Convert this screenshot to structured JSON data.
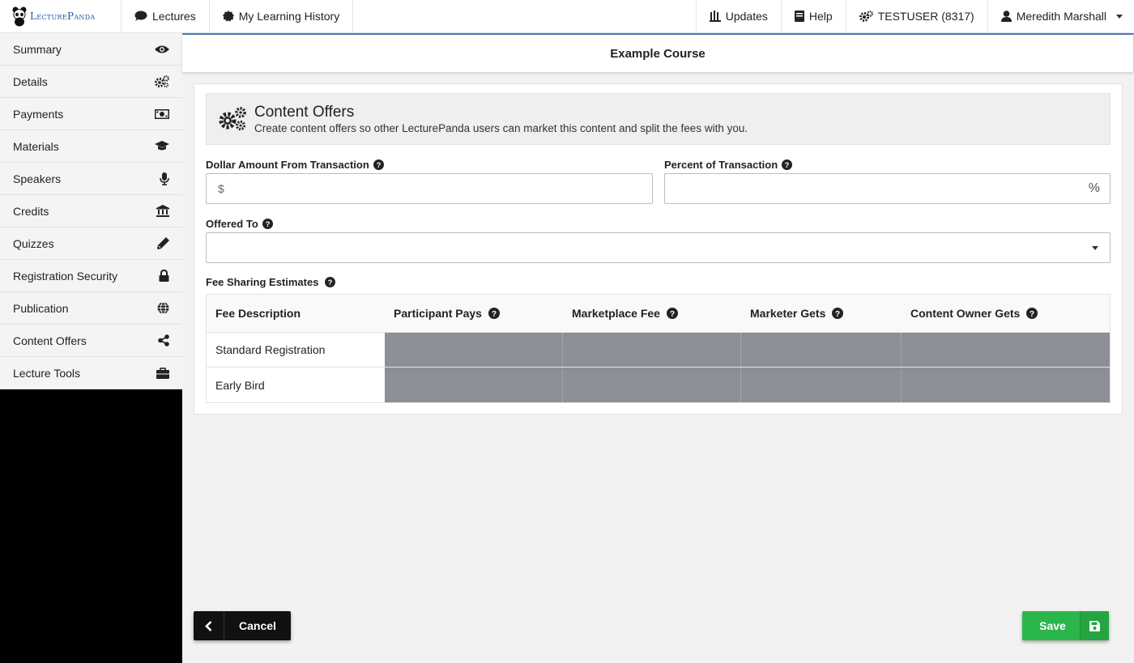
{
  "topbar": {
    "brand": "LecturePanda",
    "nav_left": [
      {
        "label": "Lectures",
        "icon": "comment-icon"
      },
      {
        "label": "My Learning History",
        "icon": "certificate-icon"
      }
    ],
    "nav_right": [
      {
        "label": "Updates",
        "icon": "updates-icon"
      },
      {
        "label": "Help",
        "icon": "book-icon"
      },
      {
        "label": "TESTUSER (8317)",
        "icon": "gears-icon"
      },
      {
        "label": "Meredith Marshall",
        "icon": "user-icon"
      }
    ]
  },
  "sidebar": {
    "items": [
      {
        "label": "Summary",
        "icon": "eye-icon"
      },
      {
        "label": "Details",
        "icon": "gears-icon"
      },
      {
        "label": "Payments",
        "icon": "money-icon"
      },
      {
        "label": "Materials",
        "icon": "graduation-cap-icon"
      },
      {
        "label": "Speakers",
        "icon": "microphone-icon"
      },
      {
        "label": "Credits",
        "icon": "university-icon"
      },
      {
        "label": "Quizzes",
        "icon": "pencil-icon"
      },
      {
        "label": "Registration Security",
        "icon": "lock-icon"
      },
      {
        "label": "Publication",
        "icon": "globe-icon"
      },
      {
        "label": "Content Offers",
        "icon": "share-icon"
      },
      {
        "label": "Lecture Tools",
        "icon": "briefcase-icon"
      }
    ]
  },
  "course": {
    "title": "Example Course"
  },
  "offers": {
    "title": "Content Offers",
    "subtitle": "Create content offers so other LecturePanda users can market this content and split the fees with you.",
    "dollar_label": "Dollar Amount From Transaction",
    "dollar_prefix": "$",
    "dollar_value": "",
    "percent_label": "Percent of Transaction",
    "percent_suffix": "%",
    "percent_value": "",
    "offered_to_label": "Offered To",
    "offered_to_value": "",
    "estimates_label": "Fee Sharing Estimates",
    "table": {
      "headers": [
        "Fee Description",
        "Participant Pays",
        "Marketplace Fee",
        "Marketer Gets",
        "Content Owner Gets"
      ],
      "rows": [
        "Standard Registration",
        "Early Bird"
      ]
    }
  },
  "buttons": {
    "cancel": "Cancel",
    "save": "Save"
  },
  "colors": {
    "accent_blue": "#4a7bbf",
    "save_green": "#2ab64a",
    "placeholder_grey": "#8c8f96"
  }
}
